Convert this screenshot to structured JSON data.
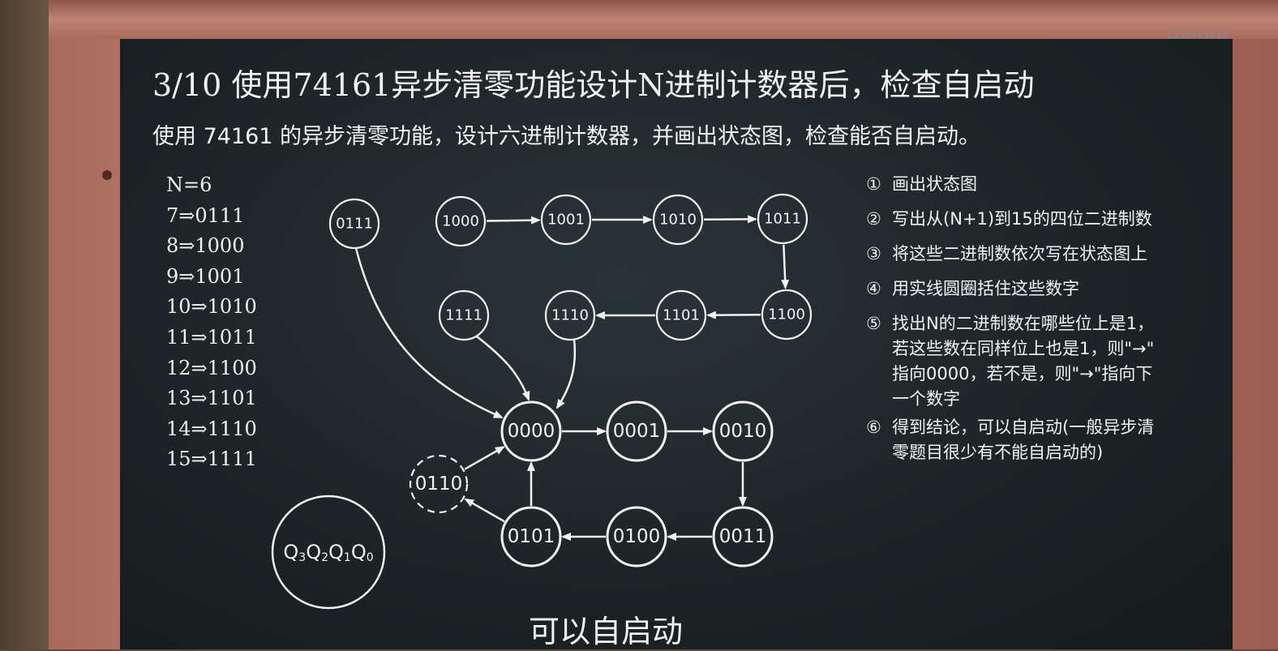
{
  "title": "3/10 使用74161异步清零功能设计N进制计数器后，检查自启动",
  "subtitle": "使用 74161 的异步清零功能，设计六进制计数器，并画出状态图，检查能否自启动。",
  "watermark": "1555965618",
  "binary_list": [
    "N=6",
    "7⇒0111",
    "8⇒1000",
    "9⇒1001",
    "10⇒1010",
    "11⇒1011",
    "12⇒1100",
    "13⇒1101",
    "14⇒1110",
    "15⇒1111"
  ],
  "steps": [
    {
      "num": "①",
      "lines": [
        "画出状态图"
      ]
    },
    {
      "num": "②",
      "lines": [
        "写出从(N+1)到15的四位二进制数"
      ]
    },
    {
      "num": "③",
      "lines": [
        "将这些二进制数依次写在状态图上"
      ]
    },
    {
      "num": "④",
      "lines": [
        "用实线圆圈括住这些数字"
      ]
    },
    {
      "num": "⑤",
      "lines": [
        "找出N的二进制数在哪些位上是1，",
        "若这些数在同样位上也是1，则\"→\"",
        "指向0000，若不是，则\"→\"指向下",
        "一个数字"
      ]
    },
    {
      "num": "⑥",
      "lines": [
        "得到结论，可以自启动(一般异步清",
        "零题目很少有不能自启动的)"
      ]
    }
  ],
  "conclusion": "可以自启动",
  "legend_label": "Q3Q2Q1Q0",
  "diagram": {
    "nodes": [
      {
        "id": "n0111",
        "label": "0111",
        "group": "extra"
      },
      {
        "id": "n1000",
        "label": "1000",
        "group": "extra"
      },
      {
        "id": "n1001",
        "label": "1001",
        "group": "extra"
      },
      {
        "id": "n1010",
        "label": "1010",
        "group": "extra"
      },
      {
        "id": "n1011",
        "label": "1011",
        "group": "extra"
      },
      {
        "id": "n1111",
        "label": "1111",
        "group": "extra"
      },
      {
        "id": "n1110",
        "label": "1110",
        "group": "extra"
      },
      {
        "id": "n1101",
        "label": "1101",
        "group": "extra"
      },
      {
        "id": "n1100",
        "label": "1100",
        "group": "extra"
      },
      {
        "id": "n0000",
        "label": "0000",
        "group": "main"
      },
      {
        "id": "n0001",
        "label": "0001",
        "group": "main"
      },
      {
        "id": "n0010",
        "label": "0010",
        "group": "main"
      },
      {
        "id": "n0011",
        "label": "0011",
        "group": "main"
      },
      {
        "id": "n0100",
        "label": "0100",
        "group": "main"
      },
      {
        "id": "n0101",
        "label": "0101",
        "group": "main"
      },
      {
        "id": "n0110",
        "label": "0110",
        "group": "transient"
      }
    ],
    "edges": [
      {
        "from": "n1000",
        "to": "n1001"
      },
      {
        "from": "n1001",
        "to": "n1010"
      },
      {
        "from": "n1010",
        "to": "n1011"
      },
      {
        "from": "n1011",
        "to": "n1100"
      },
      {
        "from": "n1100",
        "to": "n1101"
      },
      {
        "from": "n1101",
        "to": "n1110"
      },
      {
        "from": "n1110",
        "to": "n0000"
      },
      {
        "from": "n1111",
        "to": "n0000"
      },
      {
        "from": "n0111",
        "to": "n0000"
      },
      {
        "from": "n0000",
        "to": "n0001"
      },
      {
        "from": "n0001",
        "to": "n0010"
      },
      {
        "from": "n0010",
        "to": "n0011"
      },
      {
        "from": "n0011",
        "to": "n0100"
      },
      {
        "from": "n0100",
        "to": "n0101"
      },
      {
        "from": "n0101",
        "to": "n0000"
      },
      {
        "from": "n0101",
        "to": "n0110"
      },
      {
        "from": "n0110",
        "to": "n0000"
      }
    ]
  }
}
